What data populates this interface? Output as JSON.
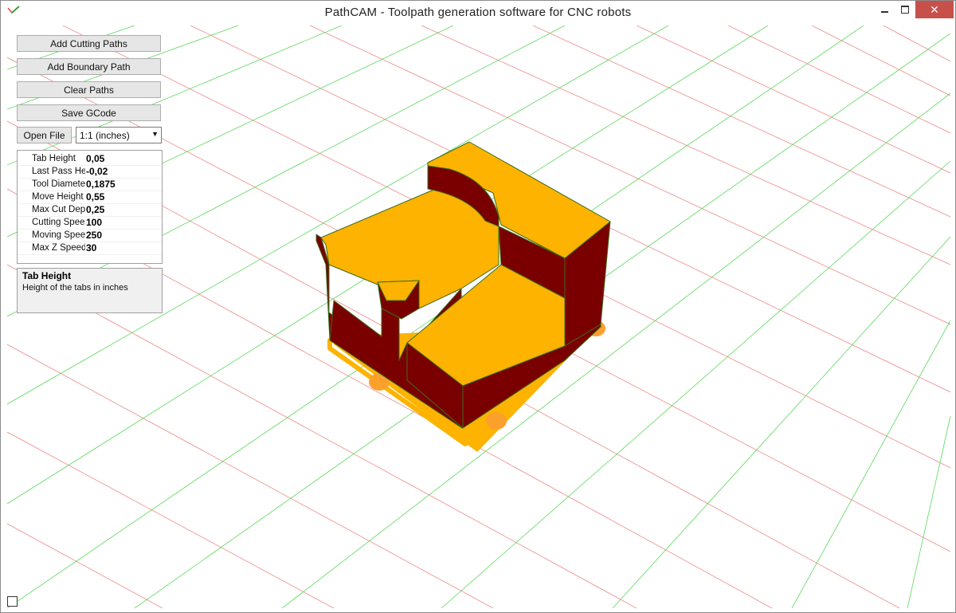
{
  "window": {
    "title": "PathCAM - Toolpath generation software for CNC robots"
  },
  "toolbar": {
    "add_cutting_paths": "Add Cutting Paths",
    "add_boundary_path": "Add Boundary Path",
    "clear_paths": "Clear Paths",
    "save_gcode": "Save GCode",
    "open_file": "Open File",
    "scale_selected": "1:1 (inches)"
  },
  "properties": [
    {
      "name": "Tab Height",
      "value": "0,05"
    },
    {
      "name": "Last Pass He",
      "value": "-0,02"
    },
    {
      "name": "Tool Diamete",
      "value": "0,1875"
    },
    {
      "name": "Move Height",
      "value": "0,55"
    },
    {
      "name": "Max Cut Dept",
      "value": "0,25"
    },
    {
      "name": "Cutting Speec",
      "value": "100"
    },
    {
      "name": "Moving Spee",
      "value": "250"
    },
    {
      "name": "Max Z Speed",
      "value": "30"
    }
  ],
  "help": {
    "title": "Tab Height",
    "description": "Height of the tabs in inches"
  },
  "colors": {
    "part_top": "#fdb300",
    "part_side": "#7a0000",
    "tab": "#fca02c",
    "grid_green": "#2bd12b",
    "grid_red": "#e85a5a",
    "close_button": "#c7504a"
  },
  "icons": {
    "app": "checkmark-icon",
    "minimize": "minimize-icon",
    "maximize": "maximize-icon",
    "close": "close-icon",
    "dropdown": "chevron-down-icon"
  }
}
